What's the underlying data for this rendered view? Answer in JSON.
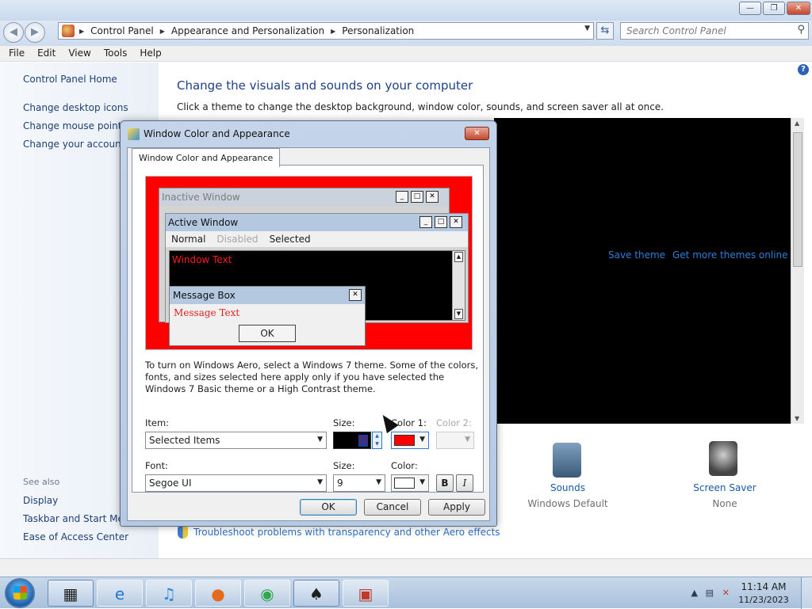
{
  "window": {
    "minimize_glyph": "—",
    "maximize_glyph": "❐",
    "close_glyph": "✕"
  },
  "address": {
    "crumbs": [
      "Control Panel",
      "Appearance and Personalization",
      "Personalization"
    ],
    "search_placeholder": "Search Control Panel"
  },
  "menu": [
    "File",
    "Edit",
    "View",
    "Tools",
    "Help"
  ],
  "left_pane": {
    "links": [
      "Control Panel Home",
      "Change desktop icons",
      "Change mouse pointers",
      "Change your account picture"
    ],
    "see_also_label": "See also",
    "see_also": [
      "Display",
      "Taskbar and Start Menu",
      "Ease of Access Center"
    ]
  },
  "main": {
    "title": "Change the visuals and sounds on your computer",
    "subtitle": "Click a theme to change the desktop background, window color, sounds, and screen saver all at once.",
    "save_theme": "Save theme",
    "get_more": "Get more themes online",
    "tiles": [
      {
        "label": "Sounds",
        "value": "Windows Default",
        "icon": "speaker-icon"
      },
      {
        "label": "Screen Saver",
        "value": "None",
        "icon": "screensaver-icon"
      }
    ],
    "troubleshoot": "Troubleshoot problems with transparency and other Aero effects"
  },
  "dialog": {
    "title": "Window Color and Appearance",
    "tab": "Window Color and Appearance",
    "preview": {
      "inactive_title": "Inactive Window",
      "active_title": "Active Window",
      "menu": [
        "Normal",
        "Disabled",
        "Selected"
      ],
      "window_text": "Window Text",
      "message_title": "Message Box",
      "message_text": "Message Text",
      "ok": "OK"
    },
    "info": "To turn on Windows Aero, select a Windows 7 theme.  Some of the colors, fonts, and sizes selected here apply only if you have selected the Windows 7 Basic theme or a High Contrast theme.",
    "item_label": "Item:",
    "item_value": "Selected Items",
    "size_label": "Size:",
    "size_value": "21",
    "color1_label": "Color 1:",
    "color2_label": "Color 2:",
    "font_label": "Font:",
    "font_value": "Segoe UI",
    "font_size_label": "Size:",
    "font_size_value": "9",
    "font_color_label": "Color:",
    "bold": "B",
    "italic": "I",
    "buttons": {
      "ok": "OK",
      "cancel": "Cancel",
      "apply": "Apply"
    }
  },
  "colors": {
    "preview_bg": "#ff0000",
    "color1": "#ff0000",
    "font_color": "#ffffff",
    "theme_area": "#000000"
  },
  "taskbar": {
    "apps": [
      "winrar-icon",
      "ie-icon",
      "itunes-icon",
      "firefox-icon",
      "chrome-icon",
      "dress-icon",
      "abc-icon"
    ],
    "time": "11:14 AM",
    "date": "11/23/2023"
  }
}
